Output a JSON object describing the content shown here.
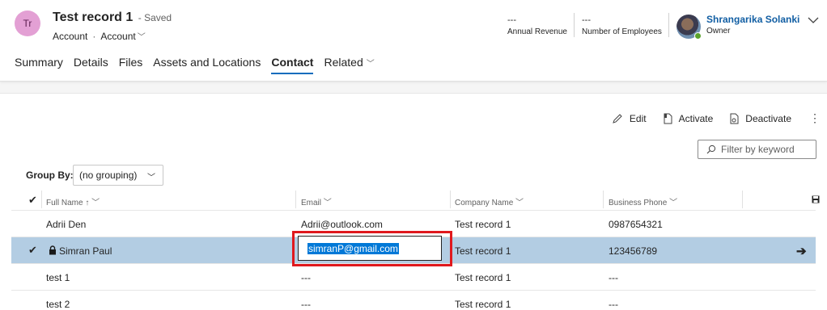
{
  "record": {
    "avatar_initials": "Tr",
    "title": "Test record 1",
    "saved_status": "- Saved",
    "entity": "Account",
    "form": "Account",
    "separator": "·"
  },
  "kpis": [
    {
      "value": "---",
      "label": "Annual Revenue"
    },
    {
      "value": "---",
      "label": "Number of Employees"
    }
  ],
  "owner": {
    "name": "Shrangarika Solanki",
    "role": "Owner",
    "status_color": "#5aa22c"
  },
  "tabs": [
    {
      "label": "Summary"
    },
    {
      "label": "Details"
    },
    {
      "label": "Files"
    },
    {
      "label": "Assets and Locations"
    },
    {
      "label": "Contact",
      "active": true
    },
    {
      "label": "Related"
    }
  ],
  "commands": {
    "edit": "Edit",
    "activate": "Activate",
    "deactivate": "Deactivate",
    "more": "⋮"
  },
  "filter": {
    "placeholder": "Filter by keyword"
  },
  "group_by": {
    "label": "Group By:",
    "value": "(no grouping)"
  },
  "columns": {
    "full_name": "Full Name",
    "email": "Email",
    "company": "Company Name",
    "phone": "Business Phone"
  },
  "rows": [
    {
      "name": "Adrii Den",
      "email": "Adrii@outlook.com",
      "company": "Test record 1",
      "phone": "0987654321"
    },
    {
      "name": "Simran Paul",
      "email": "simranP@gmail.com",
      "company": "Test record 1",
      "phone": "123456789",
      "selected": true
    },
    {
      "name": "test 1",
      "email": "---",
      "company": "Test record 1",
      "phone": "---"
    },
    {
      "name": "test 2",
      "email": "---",
      "company": "Test record 1",
      "phone": "---"
    }
  ],
  "colors": {
    "accent": "#0f6cbd",
    "selected_row": "#b3cde3",
    "highlight_box": "#e0191e",
    "text_selection": "#0078d7"
  }
}
